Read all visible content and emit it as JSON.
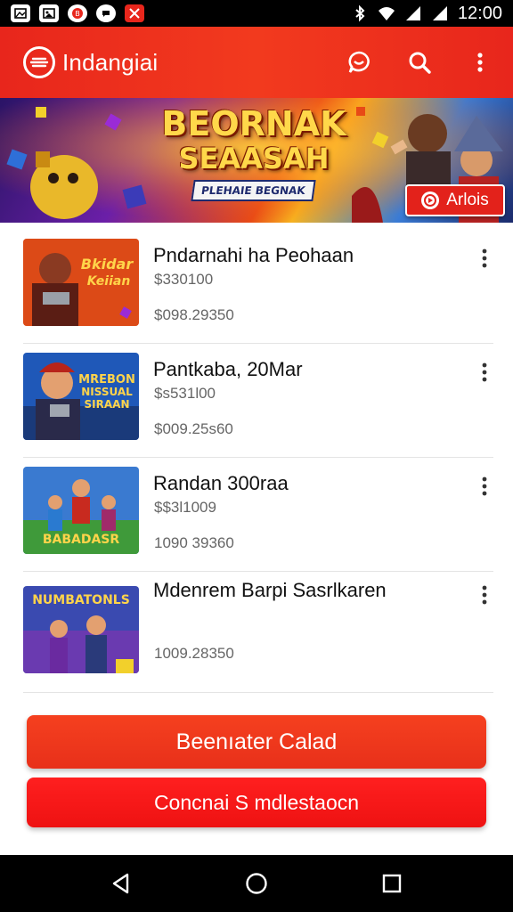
{
  "status_bar": {
    "time": "12:00",
    "icons": [
      "picture-icon",
      "image-icon",
      "badge-icon",
      "chat-icon",
      "tools-icon",
      "bluetooth-icon",
      "wifi-icon",
      "signal-icon",
      "battery-icon"
    ]
  },
  "app_bar": {
    "title": "Indangiai",
    "actions": [
      "message-icon",
      "search-icon",
      "more-vert-icon"
    ]
  },
  "banner": {
    "headline_line1": "BEORNAK",
    "headline_line2": "SEAASAH",
    "tag": "PLEHAIE BEGNAK",
    "button_label": "Arlois"
  },
  "items": [
    {
      "title": "Pndarnahi ha Peohaan",
      "price": "$330100",
      "meta": "$098.29350"
    },
    {
      "title": "Pantkaba, 20Mar",
      "price": "$s531l00",
      "meta": "$009.25s60"
    },
    {
      "title": "Randan 300raa",
      "price": "$$3l1009",
      "meta": "1090 39360"
    },
    {
      "title": "Mdenrem Barpi Sasrlkaren",
      "price": "",
      "meta": "1009.28350"
    }
  ],
  "buttons": {
    "primary": "Beenıater Calad",
    "secondary": "Concnai S mdlestaocn"
  },
  "colors": {
    "accent": "#e8261c",
    "button_primary": "#f23a1e",
    "button_secondary": "#ff1616",
    "text_primary": "#111111",
    "text_secondary": "#666666"
  }
}
